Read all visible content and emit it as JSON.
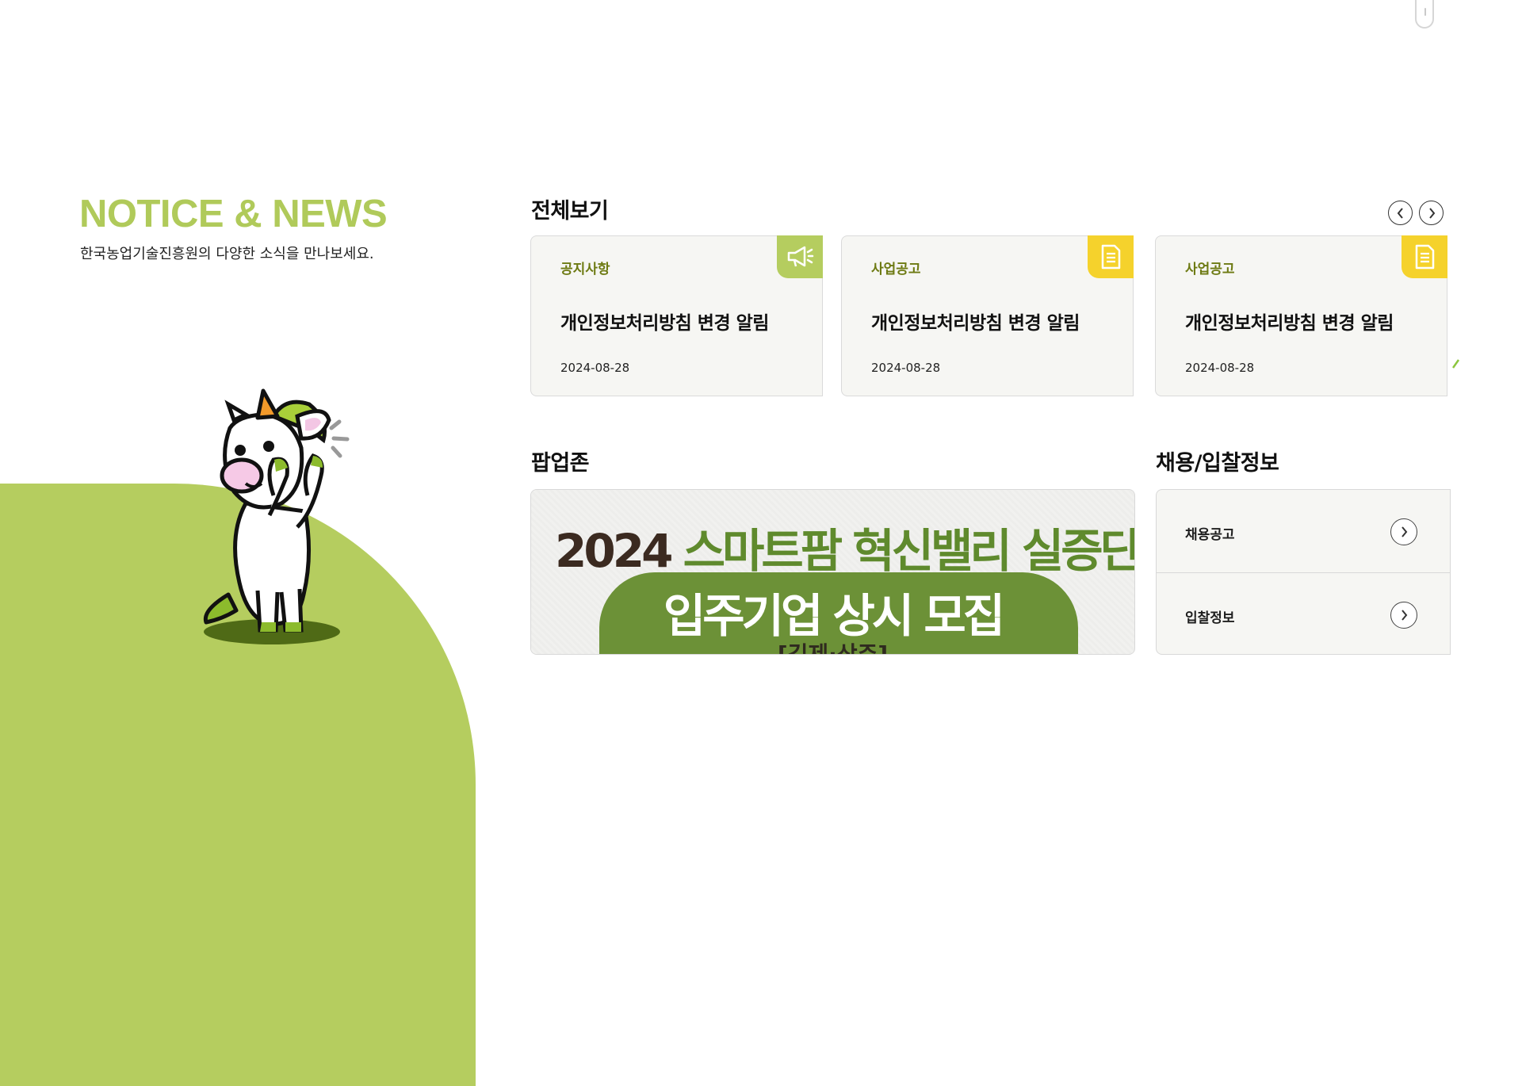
{
  "section": {
    "title": "NOTICE & NEWS",
    "subtitle": "한국농업기술진흥원의 다양한 소식을 만나보세요."
  },
  "all_view": {
    "heading": "전체보기",
    "cards": [
      {
        "category": "공지사항",
        "title": "개인정보처리방침 변경 알림",
        "date": "2024-08-28",
        "icon": "megaphone-icon",
        "icon_color": "#b5cd5f"
      },
      {
        "category": "사업공고",
        "title": "개인정보처리방침 변경 알림",
        "date": "2024-08-28",
        "icon": "document-icon",
        "icon_color": "#f5d22c"
      },
      {
        "category": "사업공고",
        "title": "개인정보처리방침 변경 알림",
        "date": "2024-08-28",
        "icon": "document-icon",
        "icon_color": "#f5d22c"
      }
    ]
  },
  "popup_zone": {
    "heading": "팝업존",
    "banner": {
      "year": "2024",
      "line1": "스마트팜 혁신밸리 실증단지",
      "line2": "입주기업 상시 모집",
      "line3": "[김제·상주]"
    }
  },
  "recruit": {
    "heading": "채용/입찰정보",
    "items": [
      {
        "label": "채용공고"
      },
      {
        "label": "입찰정보"
      }
    ]
  },
  "colors": {
    "accent_green": "#b5cd5f",
    "category_olive": "#6d7a12",
    "badge_yellow": "#f5d22c"
  }
}
